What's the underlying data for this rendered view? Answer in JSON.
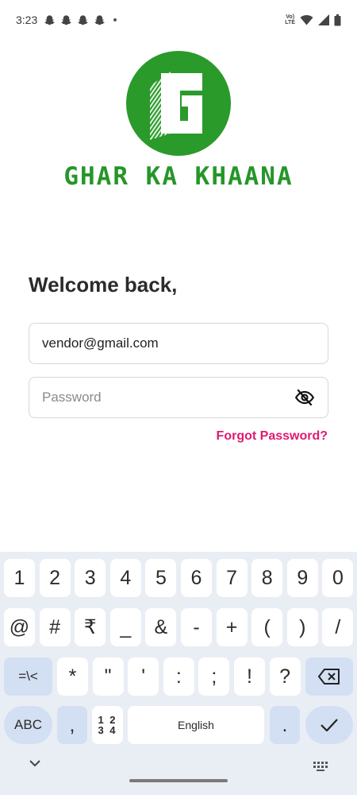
{
  "status_bar": {
    "time": "3:23",
    "notification_icons": [
      "snapchat-icon",
      "snapchat-icon",
      "snapchat-icon",
      "snapchat-icon"
    ],
    "network_label_top": "Vo)",
    "network_label_bottom": "LTE"
  },
  "brand": {
    "logo_letter": "G",
    "name": "GHAR KA KHAANA",
    "color": "#26962a"
  },
  "login": {
    "welcome": "Welcome back,",
    "email_value": "vendor@gmail.com",
    "password_placeholder": "Password",
    "forgot_password": "Forgot Password?",
    "accent_color": "#e01a72"
  },
  "keyboard": {
    "row1": [
      "1",
      "2",
      "3",
      "4",
      "5",
      "6",
      "7",
      "8",
      "9",
      "0"
    ],
    "row2": [
      "@",
      "#",
      "₹",
      "_",
      "&",
      "-",
      "+",
      "(",
      ")",
      "/"
    ],
    "row3_shift": "=\\<",
    "row3": [
      "*",
      "\"",
      "'",
      ":",
      ";",
      "!",
      "?"
    ],
    "abc_label": "ABC",
    "comma": ",",
    "numpad_top": "1 2",
    "numpad_bottom": "3 4",
    "space_label": "English",
    "period": "."
  }
}
